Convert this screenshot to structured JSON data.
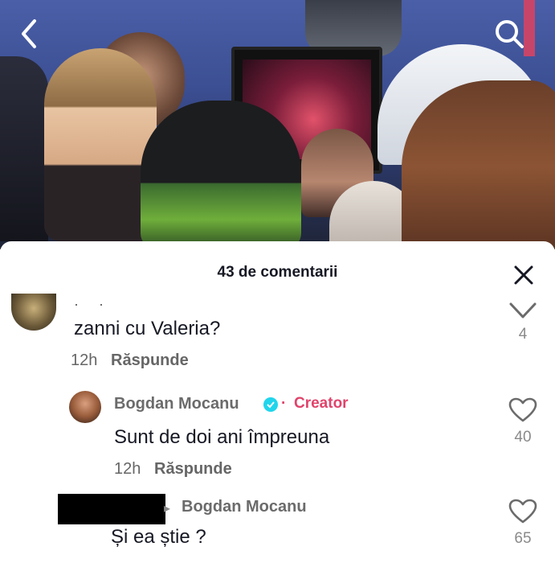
{
  "nav": {
    "back_icon": "chevron-left-icon",
    "search_icon": "search-icon"
  },
  "comments_panel": {
    "title": "43 de comentarii",
    "close_icon": "close-icon"
  },
  "comments": [
    {
      "text": "zanni cu Valeria?",
      "time": "12h",
      "reply_label": "Răspunde",
      "like_icon": "chevron-down-icon",
      "likes": "4"
    },
    {
      "author": "Bogdan Mocanu",
      "verified": true,
      "badge_separator": "·",
      "badge": "Creator",
      "text": "Sunt de doi ani împreuna",
      "time": "12h",
      "reply_label": "Răspunde",
      "like_icon": "heart-icon",
      "likes": "40"
    },
    {
      "reply_to": "Bogdan Mocanu",
      "text": "Și ea știe ?",
      "like_icon": "heart-icon",
      "likes": "65"
    }
  ],
  "colors": {
    "creator": "#e0436b",
    "verified": "#20d5ec",
    "text": "#161823"
  }
}
